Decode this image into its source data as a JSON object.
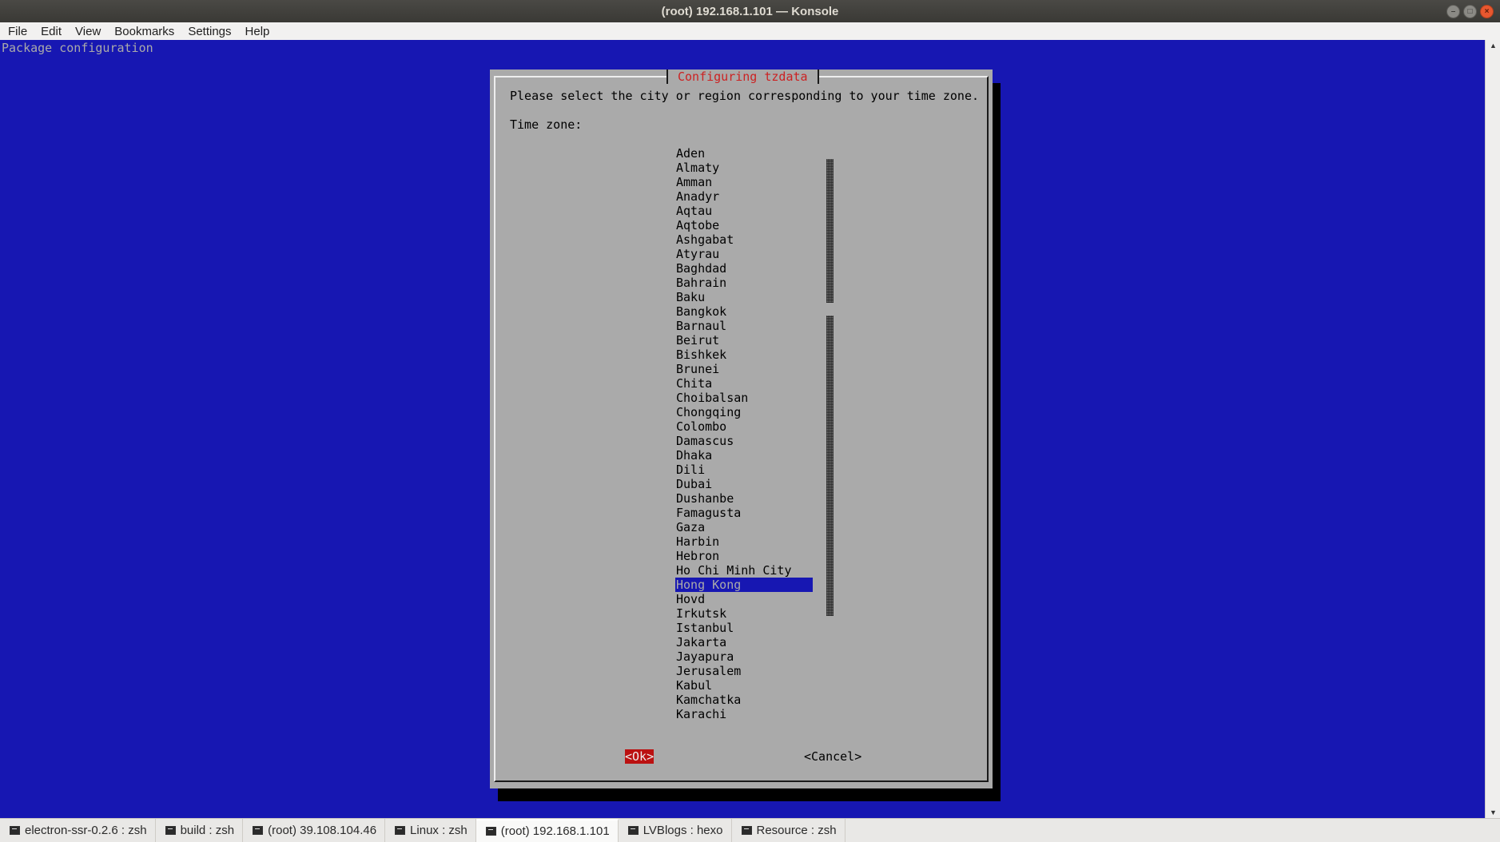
{
  "window": {
    "title": "(root) 192.168.1.101 — Konsole",
    "controls": {
      "minimize": "–",
      "maximize": "□",
      "close": "×"
    }
  },
  "menubar": {
    "items": [
      "File",
      "Edit",
      "View",
      "Bookmarks",
      "Settings",
      "Help"
    ]
  },
  "terminal": {
    "header": "Package configuration",
    "dialog": {
      "title": "Configuring tzdata",
      "prompt": "Please select the city or region corresponding to your time zone.",
      "field_label": "Time zone:",
      "options": [
        "Aden",
        "Almaty",
        "Amman",
        "Anadyr",
        "Aqtau",
        "Aqtobe",
        "Ashgabat",
        "Atyrau",
        "Baghdad",
        "Bahrain",
        "Baku",
        "Bangkok",
        "Barnaul",
        "Beirut",
        "Bishkek",
        "Brunei",
        "Chita",
        "Choibalsan",
        "Chongqing",
        "Colombo",
        "Damascus",
        "Dhaka",
        "Dili",
        "Dubai",
        "Dushanbe",
        "Famagusta",
        "Gaza",
        "Harbin",
        "Hebron",
        "Ho Chi Minh City",
        "Hong Kong",
        "Hovd",
        "Irkutsk",
        "Istanbul",
        "Jakarta",
        "Jayapura",
        "Jerusalem",
        "Kabul",
        "Kamchatka",
        "Karachi"
      ],
      "selected_option": "Hong Kong",
      "ok_label": "<Ok>",
      "cancel_label": "<Cancel>"
    },
    "colors": {
      "background": "#1717b2",
      "dialog": "#aaaaaa",
      "title_text": "#cc2222",
      "ok_button": "#bb1111",
      "selection": "#1717b2"
    }
  },
  "tabs": [
    {
      "label": "electron-ssr-0.2.6 : zsh",
      "active": false
    },
    {
      "label": "build : zsh",
      "active": false
    },
    {
      "label": "(root) 39.108.104.46",
      "active": false
    },
    {
      "label": "Linux : zsh",
      "active": false
    },
    {
      "label": "(root) 192.168.1.101",
      "active": true
    },
    {
      "label": "LVBlogs : hexo",
      "active": false
    },
    {
      "label": "Resource : zsh",
      "active": false
    }
  ]
}
